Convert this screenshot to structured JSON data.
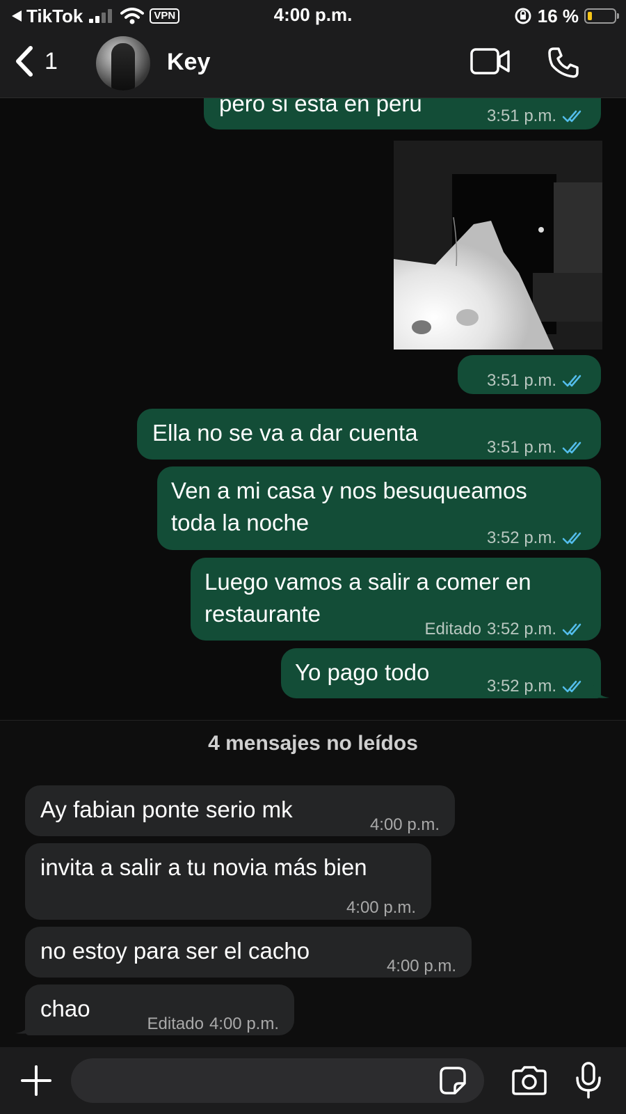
{
  "status_bar": {
    "back_app": "TikTok",
    "vpn": "VPN",
    "time": "4:00 p.m.",
    "battery": "16 %",
    "battery_level": 0.16,
    "battery_color": "#f5c518"
  },
  "header": {
    "back_count": "1",
    "contact_name": "Key",
    "icons": [
      "chevron-left-icon",
      "avatar",
      "video-call-icon",
      "phone-icon"
    ]
  },
  "messages_out": [
    {
      "text": "pero si esta en peru",
      "time": "3:51 p.m."
    },
    {
      "text": "",
      "time": "3:51 p.m.",
      "type": "image"
    },
    {
      "text": "Ella no se va a dar cuenta",
      "time": "3:51 p.m."
    },
    {
      "text_line1": "Ven a mi casa y nos besuqueamos",
      "text_line2": "toda la noche",
      "time": "3:52 p.m."
    },
    {
      "text_line1": "Luego vamos a salir a comer en",
      "text_line2": "restaurante",
      "edited": "Editado",
      "time": "3:52 p.m."
    },
    {
      "text": "Yo pago todo",
      "time": "3:52 p.m."
    }
  ],
  "unread_banner": "4 mensajes no leídos",
  "messages_in": [
    {
      "text": "Ay fabian ponte serio mk",
      "time": "4:00 p.m."
    },
    {
      "text": "invita a salir a tu novia más bien",
      "time": "4:00 p.m."
    },
    {
      "text": "no estoy para ser el cacho",
      "time": "4:00 p.m."
    },
    {
      "text": "chao",
      "edited": "Editado",
      "time": "4:00 p.m."
    }
  ],
  "composer": {
    "placeholder": "",
    "icons": [
      "plus-icon",
      "sticker-icon",
      "camera-icon",
      "microphone-icon"
    ]
  },
  "colors": {
    "outgoing_bubble": "#134d37",
    "incoming_bubble": "#242526",
    "read_ticks": "#53bdeb",
    "background": "#0b0b0b"
  }
}
